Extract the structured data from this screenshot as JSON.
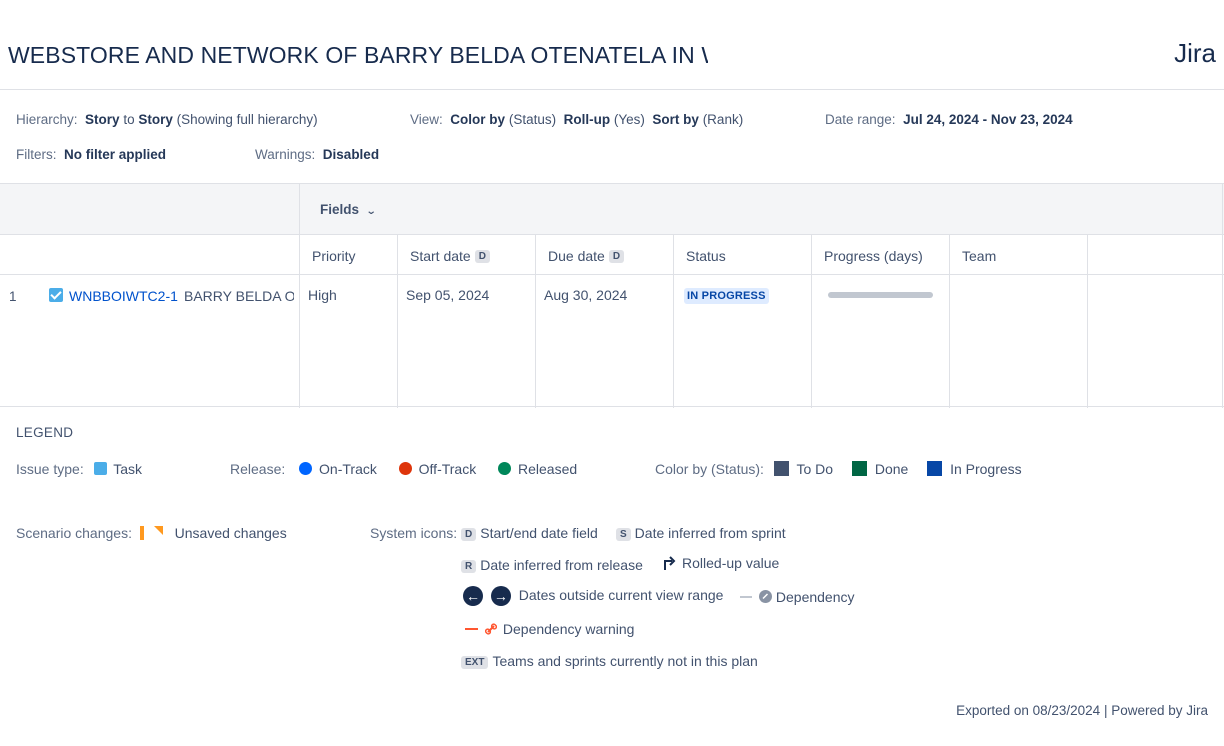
{
  "header": {
    "title": "WEBSTORE AND NETWORK OF BARRY BELDA OTENATELA IN WOT",
    "brand": "Jira"
  },
  "meta": {
    "hierarchy_label": "Hierarchy:",
    "hierarchy_from": "Story",
    "hierarchy_to_word": "to",
    "hierarchy_to": "Story",
    "hierarchy_note": "(Showing full hierarchy)",
    "view_label": "View:",
    "color_by": "Color by",
    "color_by_val": "(Status)",
    "rollup": "Roll-up",
    "rollup_val": "(Yes)",
    "sort_by": "Sort by",
    "sort_by_val": "(Rank)",
    "date_range_label": "Date range:",
    "date_range": "Jul 24, 2024 - Nov 23, 2024",
    "filters_label": "Filters:",
    "filters_val": "No filter applied",
    "warnings_label": "Warnings:",
    "warnings_val": "Disabled"
  },
  "table": {
    "fields_label": "Fields",
    "columns": {
      "priority": "Priority",
      "start_date": "Start date",
      "due_date": "Due date",
      "status": "Status",
      "progress": "Progress (days)",
      "team": "Team"
    },
    "date_badge": "D",
    "rows": [
      {
        "num": "1",
        "key": "WNBBOIWTC2-1",
        "summary": "BARRY BELDA OTENATELA",
        "priority": "High",
        "start_date": "Sep 05, 2024",
        "due_date": "Aug 30, 2024",
        "status": "IN PROGRESS",
        "progress_fraction": 0,
        "team": ""
      }
    ]
  },
  "legend": {
    "title": "LEGEND",
    "issue_type_label": "Issue type:",
    "task": "Task",
    "release_label": "Release:",
    "on_track": "On-Track",
    "off_track": "Off-Track",
    "released": "Released",
    "color_by_label": "Color by (Status):",
    "todo": "To Do",
    "done": "Done",
    "in_progress": "In Progress",
    "scenario_label": "Scenario changes:",
    "unsaved": "Unsaved changes",
    "system_icons_label": "System icons:",
    "badge_d": "D",
    "start_end": "Start/end date field",
    "badge_s": "S",
    "sprint": "Date inferred from sprint",
    "badge_r": "R",
    "release_inferred": "Date inferred from release",
    "rolled_up": "Rolled-up value",
    "outside_range": "Dates outside current view range",
    "dependency": "Dependency",
    "dependency_warning": "Dependency warning",
    "badge_ext": "EXT",
    "ext_text": "Teams and sprints currently not in this plan"
  },
  "colors": {
    "todo": "#42526e",
    "done": "#006644",
    "in_progress": "#0747a6",
    "on_track": "#0065ff",
    "off_track": "#de350b",
    "released": "#00875a",
    "task": "#4bade8",
    "unsaved": "#ff991f"
  },
  "footer": {
    "text": "Exported on 08/23/2024 | Powered by Jira"
  }
}
